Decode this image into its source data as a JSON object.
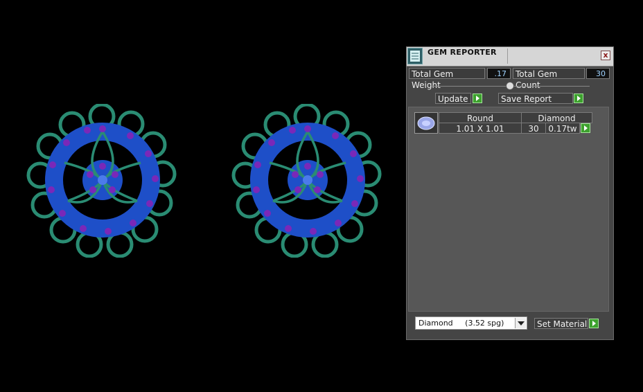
{
  "panel": {
    "title": "GEM REPORTER",
    "close_label": "x",
    "total_gem_weight_label": "Total Gem Weight",
    "total_gem_weight_value": ".17",
    "total_gem_count_label": "Total Gem Count",
    "total_gem_count_value": "30",
    "update_label": "Update",
    "save_report_label": "Save Report",
    "gem_list": {
      "headers": [
        "Round",
        "Diamond"
      ],
      "rows": [
        {
          "size": "1.01 X 1.01",
          "count": "30",
          "weight": "0.17tw"
        }
      ]
    },
    "material_select_value": "Diamond     (3.52 spg)",
    "set_material_label": "Set Material"
  },
  "colors": {
    "background": "#000000",
    "metal": "#2a8c73",
    "blue_stones": "#1e4fc8",
    "purple_stones": "#7a28b8",
    "go_button": "#3da12e"
  },
  "icons": {
    "app": "gem-reporter-icon",
    "close": "close-icon",
    "go": "green-arrow-icon",
    "dropdown": "chevron-down-icon",
    "gem_thumbnail": "round-gem-icon"
  }
}
